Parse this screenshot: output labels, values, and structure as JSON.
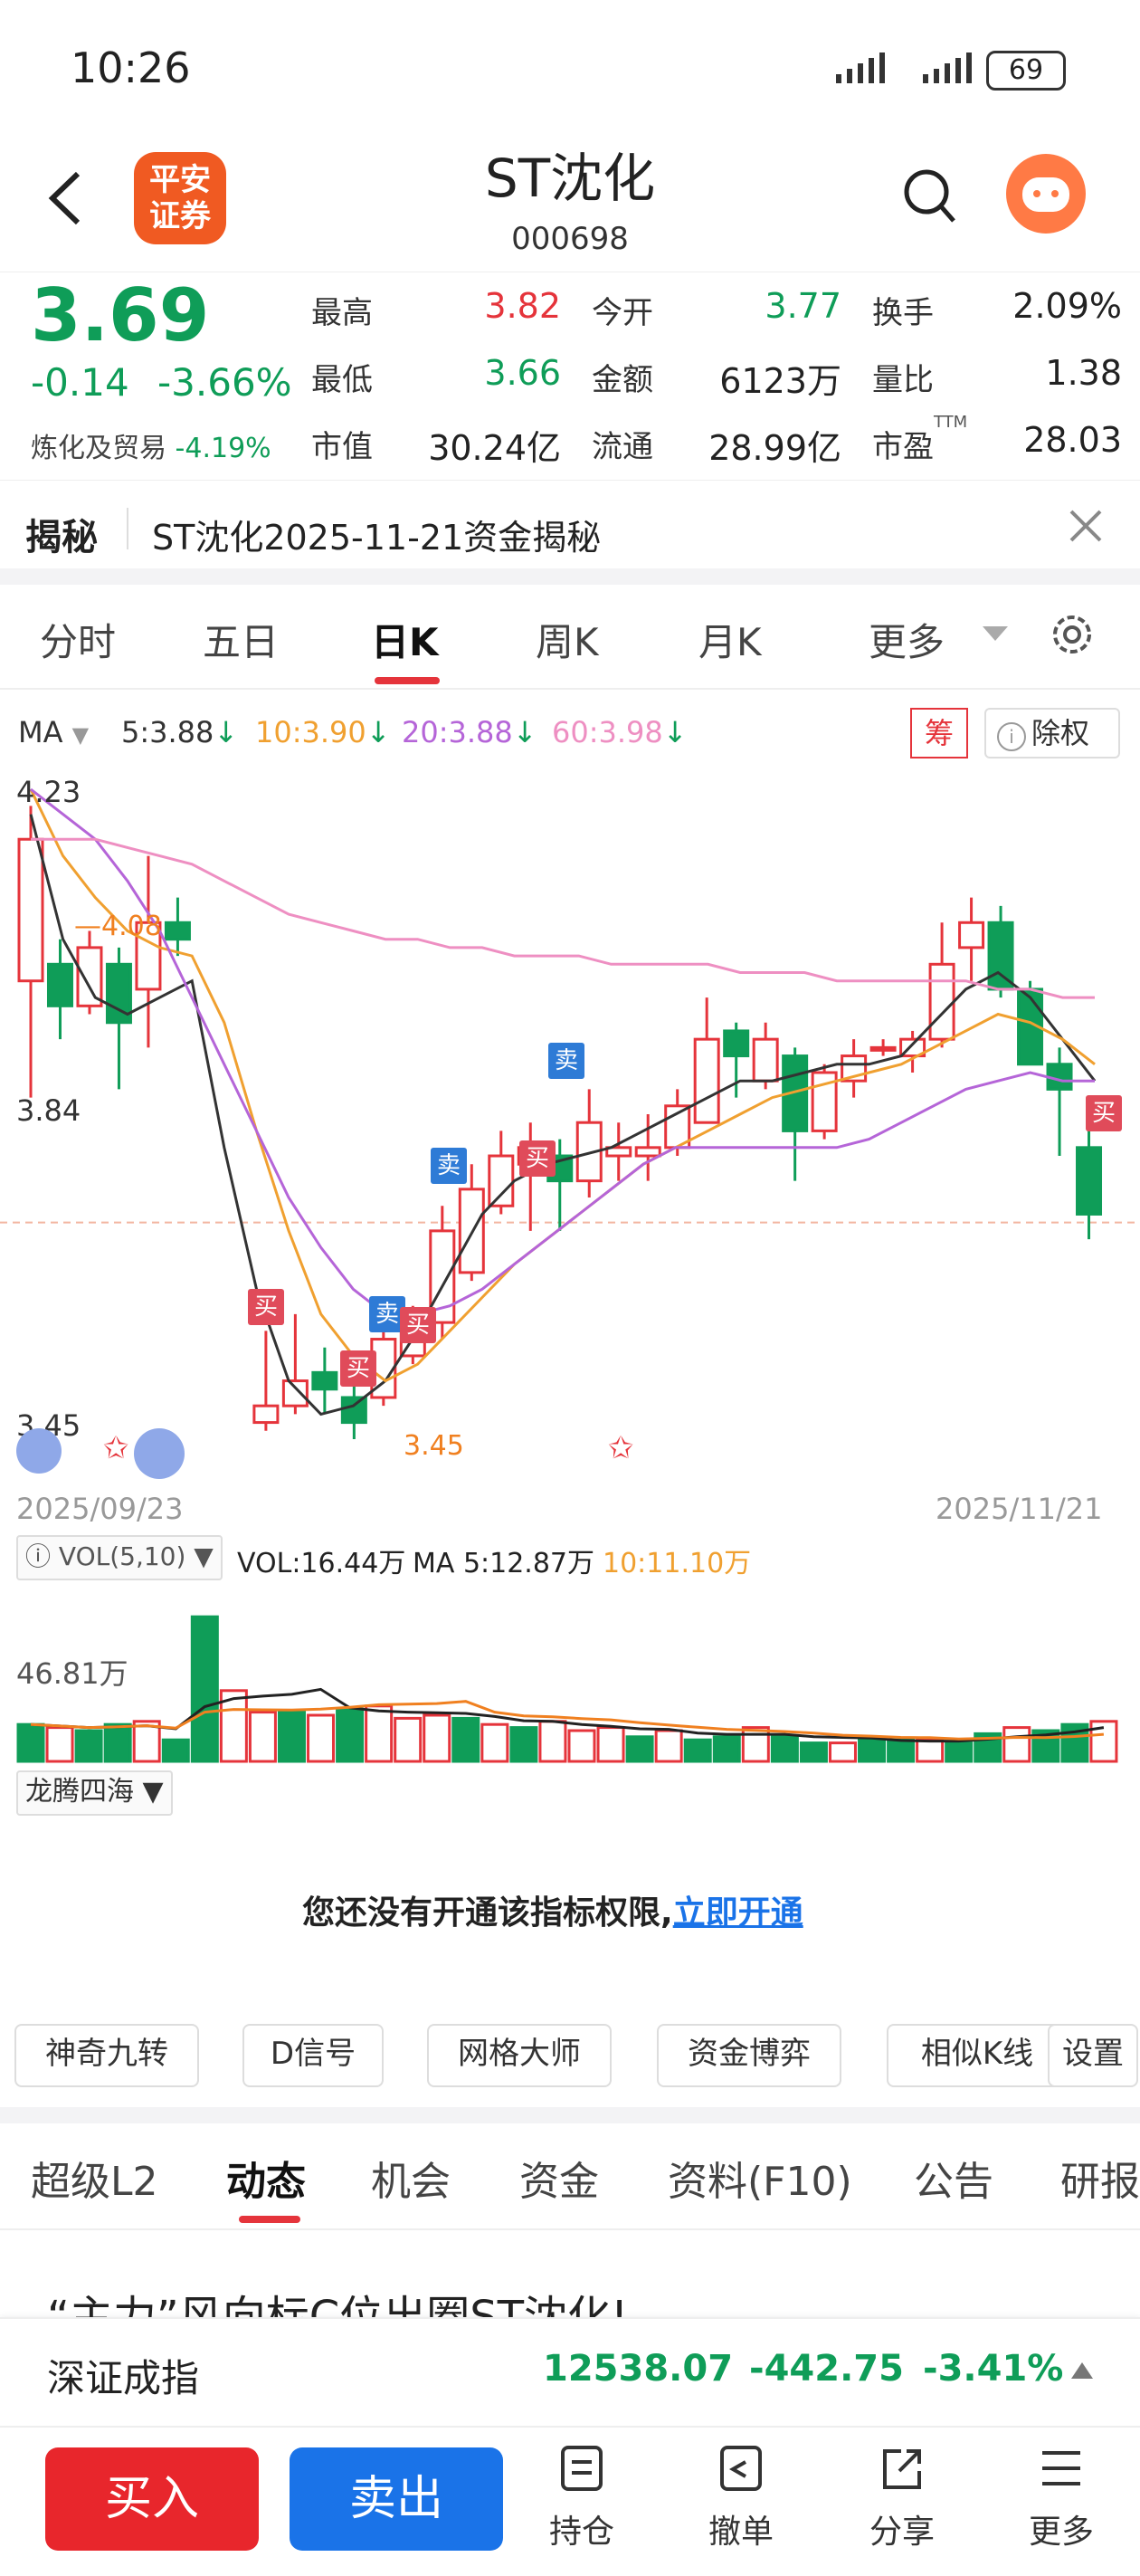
{
  "status": {
    "time": "10:26",
    "battery": "69"
  },
  "header": {
    "logo_line1": "平安",
    "logo_line2": "证券",
    "name": "ST沈化",
    "code": "000698"
  },
  "quote": {
    "price": "3.69",
    "change": "-0.14",
    "change_pct": "-3.66%",
    "industry_label": "炼化及贸易",
    "industry_pct": "-4.19%",
    "high_label": "最高",
    "high": "3.82",
    "open_label": "今开",
    "open": "3.77",
    "turnover_label": "换手",
    "turnover": "2.09%",
    "low_label": "最低",
    "low": "3.66",
    "amount_label": "金额",
    "amount": "6123万",
    "vol_ratio_label": "量比",
    "vol_ratio": "1.38",
    "mktcap_label": "市值",
    "mktcap": "30.24亿",
    "float_label": "流通",
    "float": "28.99亿",
    "pe_label": "市盈",
    "pe_sup": "TTM",
    "pe": "28.03"
  },
  "banner": {
    "tag": "揭秘",
    "text": "ST沈化2025-11-21资金揭秘"
  },
  "chart_tabs": [
    "分时",
    "五日",
    "日K",
    "周K",
    "月K",
    "更多"
  ],
  "ma_legend": {
    "ma": "MA",
    "ma5": "5:3.88",
    "ma10": "10:3.90",
    "ma20": "20:3.88",
    "ma60": "60:3.98",
    "chip": "筹",
    "adjust": "除权",
    "c_ma5": "#333333",
    "c_ma10": "#f0a030",
    "c_ma20": "#b565d8",
    "c_ma60": "#ee8fc2"
  },
  "chart_labels": {
    "y_top": "4.23",
    "y_mid": "3.84",
    "y_low": "3.45",
    "high_mark": "4.08",
    "low_mark": "3.45",
    "date_start": "2025/09/23",
    "date_end": "2025/11/21",
    "buy": "买",
    "sell": "卖"
  },
  "vol_legend": {
    "name": "VOL(5,10)",
    "vol": "VOL:16.44万",
    "ma5": "MA 5:12.87万",
    "ma10": "10:11.10万",
    "y_label": "46.81万"
  },
  "indicator": {
    "name": "龙腾四海",
    "notice": "您还没有开通该指标权限,",
    "link": "立即开通"
  },
  "tools": [
    "神奇九转",
    "D信号",
    "网格大师",
    "资金博弈",
    "相似K线",
    "设置"
  ],
  "sub_tabs": [
    "超级L2",
    "动态",
    "机会",
    "资金",
    "资料(F10)",
    "公告",
    "研报"
  ],
  "news_title": "“主力”风向标C位出圈ST沈化!",
  "index": {
    "name": "深证成指",
    "value": "12538.07",
    "change": "-442.75",
    "pct": "-3.41%"
  },
  "bottom": {
    "buy": "买入",
    "sell": "卖出",
    "hold": "持仓",
    "cancel": "撤单",
    "share": "分享",
    "more": "更多"
  },
  "chart_data": {
    "type": "candlestick",
    "x_range": [
      "2025/09/23",
      "2025/11/21"
    ],
    "y_ticks": [
      4.23,
      3.84,
      3.45
    ],
    "candles": [
      {
        "o": 4.0,
        "c": 4.17,
        "h": 4.21,
        "l": 3.86
      },
      {
        "o": 4.02,
        "c": 3.97,
        "h": 4.05,
        "l": 3.93
      },
      {
        "o": 3.97,
        "c": 4.04,
        "h": 4.06,
        "l": 3.96
      },
      {
        "o": 4.02,
        "c": 3.95,
        "h": 4.04,
        "l": 3.87
      },
      {
        "o": 3.99,
        "c": 4.07,
        "h": 4.15,
        "l": 3.92
      },
      {
        "o": 4.07,
        "c": 4.05,
        "h": 4.1,
        "l": 4.03
      },
      {
        "o": 3.47,
        "c": 3.49,
        "h": 3.58,
        "l": 3.46
      },
      {
        "o": 3.49,
        "c": 3.52,
        "h": 3.6,
        "l": 3.48
      },
      {
        "o": 3.53,
        "c": 3.51,
        "h": 3.56,
        "l": 3.48
      },
      {
        "o": 3.5,
        "c": 3.47,
        "h": 3.52,
        "l": 3.45
      },
      {
        "o": 3.5,
        "c": 3.57,
        "h": 3.6,
        "l": 3.49
      },
      {
        "o": 3.55,
        "c": 3.58,
        "h": 3.61,
        "l": 3.54
      },
      {
        "o": 3.59,
        "c": 3.7,
        "h": 3.73,
        "l": 3.57
      },
      {
        "o": 3.65,
        "c": 3.75,
        "h": 3.78,
        "l": 3.64
      },
      {
        "o": 3.73,
        "c": 3.79,
        "h": 3.82,
        "l": 3.72
      },
      {
        "o": 3.78,
        "c": 3.8,
        "h": 3.83,
        "l": 3.7
      },
      {
        "o": 3.79,
        "c": 3.76,
        "h": 3.81,
        "l": 3.7
      },
      {
        "o": 3.76,
        "c": 3.83,
        "h": 3.87,
        "l": 3.74
      },
      {
        "o": 3.79,
        "c": 3.8,
        "h": 3.83,
        "l": 3.76
      },
      {
        "o": 3.79,
        "c": 3.8,
        "h": 3.84,
        "l": 3.76
      },
      {
        "o": 3.8,
        "c": 3.85,
        "h": 3.87,
        "l": 3.79
      },
      {
        "o": 3.83,
        "c": 3.93,
        "h": 3.98,
        "l": 3.83
      },
      {
        "o": 3.94,
        "c": 3.91,
        "h": 3.95,
        "l": 3.86
      },
      {
        "o": 3.88,
        "c": 3.93,
        "h": 3.95,
        "l": 3.87
      },
      {
        "o": 3.91,
        "c": 3.82,
        "h": 3.92,
        "l": 3.76
      },
      {
        "o": 3.82,
        "c": 3.89,
        "h": 3.9,
        "l": 3.81
      },
      {
        "o": 3.88,
        "c": 3.91,
        "h": 3.93,
        "l": 3.86
      },
      {
        "o": 3.92,
        "c": 3.92,
        "h": 3.93,
        "l": 3.91
      },
      {
        "o": 3.91,
        "c": 3.93,
        "h": 3.94,
        "l": 3.89
      },
      {
        "o": 3.93,
        "c": 4.02,
        "h": 4.07,
        "l": 3.92
      },
      {
        "o": 4.04,
        "c": 4.07,
        "h": 4.1,
        "l": 4.0
      },
      {
        "o": 4.07,
        "c": 3.99,
        "h": 4.09,
        "l": 3.98
      },
      {
        "o": 3.99,
        "c": 3.9,
        "h": 4.0,
        "l": 3.9
      },
      {
        "o": 3.9,
        "c": 3.87,
        "h": 3.92,
        "l": 3.79
      },
      {
        "o": 3.8,
        "c": 3.72,
        "h": 3.86,
        "l": 3.69
      }
    ],
    "ma5": [
      4.2,
      4.05,
      3.98,
      3.96,
      3.98,
      4.0,
      3.8,
      3.63,
      3.52,
      3.48,
      3.49,
      3.52,
      3.58,
      3.65,
      3.72,
      3.76,
      3.78,
      3.79,
      3.8,
      3.82,
      3.84,
      3.86,
      3.88,
      3.88,
      3.89,
      3.9,
      3.9,
      3.91,
      3.95,
      3.99,
      4.01,
      3.98,
      3.93,
      3.88
    ],
    "ma10": [
      4.23,
      4.15,
      4.1,
      4.06,
      4.04,
      4.03,
      3.95,
      3.82,
      3.7,
      3.6,
      3.55,
      3.52,
      3.54,
      3.58,
      3.62,
      3.66,
      3.69,
      3.72,
      3.75,
      3.78,
      3.8,
      3.82,
      3.84,
      3.86,
      3.87,
      3.88,
      3.89,
      3.9,
      3.92,
      3.94,
      3.96,
      3.95,
      3.93,
      3.9
    ],
    "ma20": [
      4.23,
      4.2,
      4.17,
      4.12,
      4.06,
      3.98,
      3.9,
      3.82,
      3.74,
      3.68,
      3.63,
      3.6,
      3.6,
      3.61,
      3.63,
      3.66,
      3.69,
      3.72,
      3.75,
      3.78,
      3.8,
      3.8,
      3.8,
      3.8,
      3.8,
      3.8,
      3.81,
      3.83,
      3.85,
      3.87,
      3.88,
      3.89,
      3.88,
      3.88
    ],
    "ma60": [
      4.17,
      4.17,
      4.17,
      4.16,
      4.15,
      4.14,
      4.12,
      4.1,
      4.08,
      4.07,
      4.06,
      4.05,
      4.05,
      4.04,
      4.04,
      4.03,
      4.03,
      4.03,
      4.02,
      4.02,
      4.02,
      4.02,
      4.01,
      4.01,
      4.01,
      4.0,
      4.0,
      4.0,
      4.0,
      4.0,
      3.99,
      3.99,
      3.98,
      3.98
    ],
    "volume": [
      12,
      11,
      10,
      12,
      13,
      7,
      47,
      23,
      16,
      16,
      15,
      17,
      18,
      14,
      15,
      14,
      12,
      11,
      13,
      10,
      11,
      8,
      10,
      7,
      8,
      11,
      8,
      6,
      6,
      7,
      7,
      7,
      6,
      9,
      11,
      10,
      12,
      13
    ]
  }
}
